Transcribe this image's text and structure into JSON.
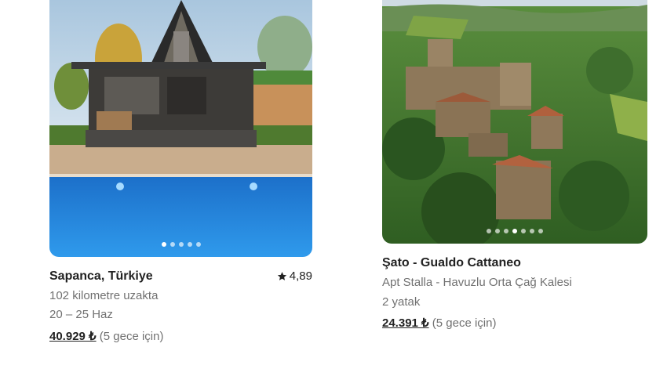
{
  "listings": [
    {
      "title": "Sapanca, Türkiye",
      "rating": "4,89",
      "rating_icon": "star-icon",
      "distance": "102 kilometre uzakta",
      "dates": "20 – 25 Haz",
      "price": "40.929 ₺",
      "price_note": "(5 gece için)",
      "photo_dots": 5,
      "active_dot": 0
    },
    {
      "title": "Şato - Gualdo Cattaneo",
      "subtitle": "Apt Stalla - Havuzlu Orta Çağ Kalesi",
      "beds": "2 yatak",
      "price": "24.391 ₺",
      "price_note": "(5 gece için)",
      "photo_dots": 7,
      "active_dot": 3
    }
  ],
  "colors": {
    "text_primary": "#222222",
    "text_secondary": "#717171",
    "pool": "#1e7fd6",
    "greenery": "#3f7a2a"
  }
}
